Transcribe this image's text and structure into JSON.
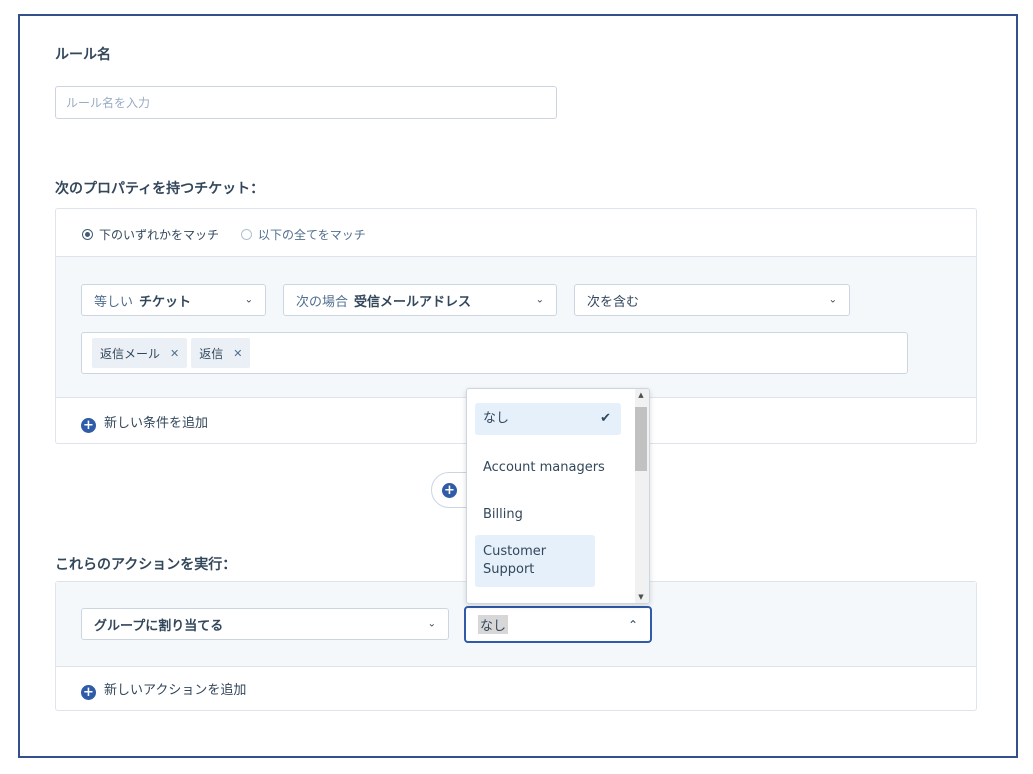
{
  "rule_name": {
    "label": "ルール名",
    "placeholder": "ルール名を入力"
  },
  "conditions": {
    "heading": "次のプロパティを持つチケット：",
    "match_any": "下のいずれかをマッチ",
    "match_all": "以下の全てをマッチ",
    "selects": [
      {
        "prefix": "等しい",
        "value": "チケット"
      },
      {
        "prefix": "次の場合",
        "value": "受信メールアドレス"
      },
      {
        "prefix": "",
        "value": "次を含む"
      }
    ],
    "tags": [
      "返信メール",
      "返信"
    ],
    "add_condition": "新しい条件を追加"
  },
  "actions": {
    "heading": "これらのアクションを実行：",
    "action_select": "グループに割り当てる",
    "group_select_value": "なし",
    "add_action": "新しいアクションを追加"
  },
  "group_dropdown": {
    "options": [
      "なし",
      "Account managers",
      "Billing",
      "Customer Support"
    ],
    "selected": "なし"
  },
  "icons": [
    "plus-circle-icon",
    "chevron-down-icon",
    "chevron-up-icon",
    "check-icon",
    "close-icon"
  ],
  "colors": {
    "accent": "#2f5ba8",
    "frame": "#33508a",
    "text": "#33475b",
    "option_highlight": "#e5f0fb"
  }
}
